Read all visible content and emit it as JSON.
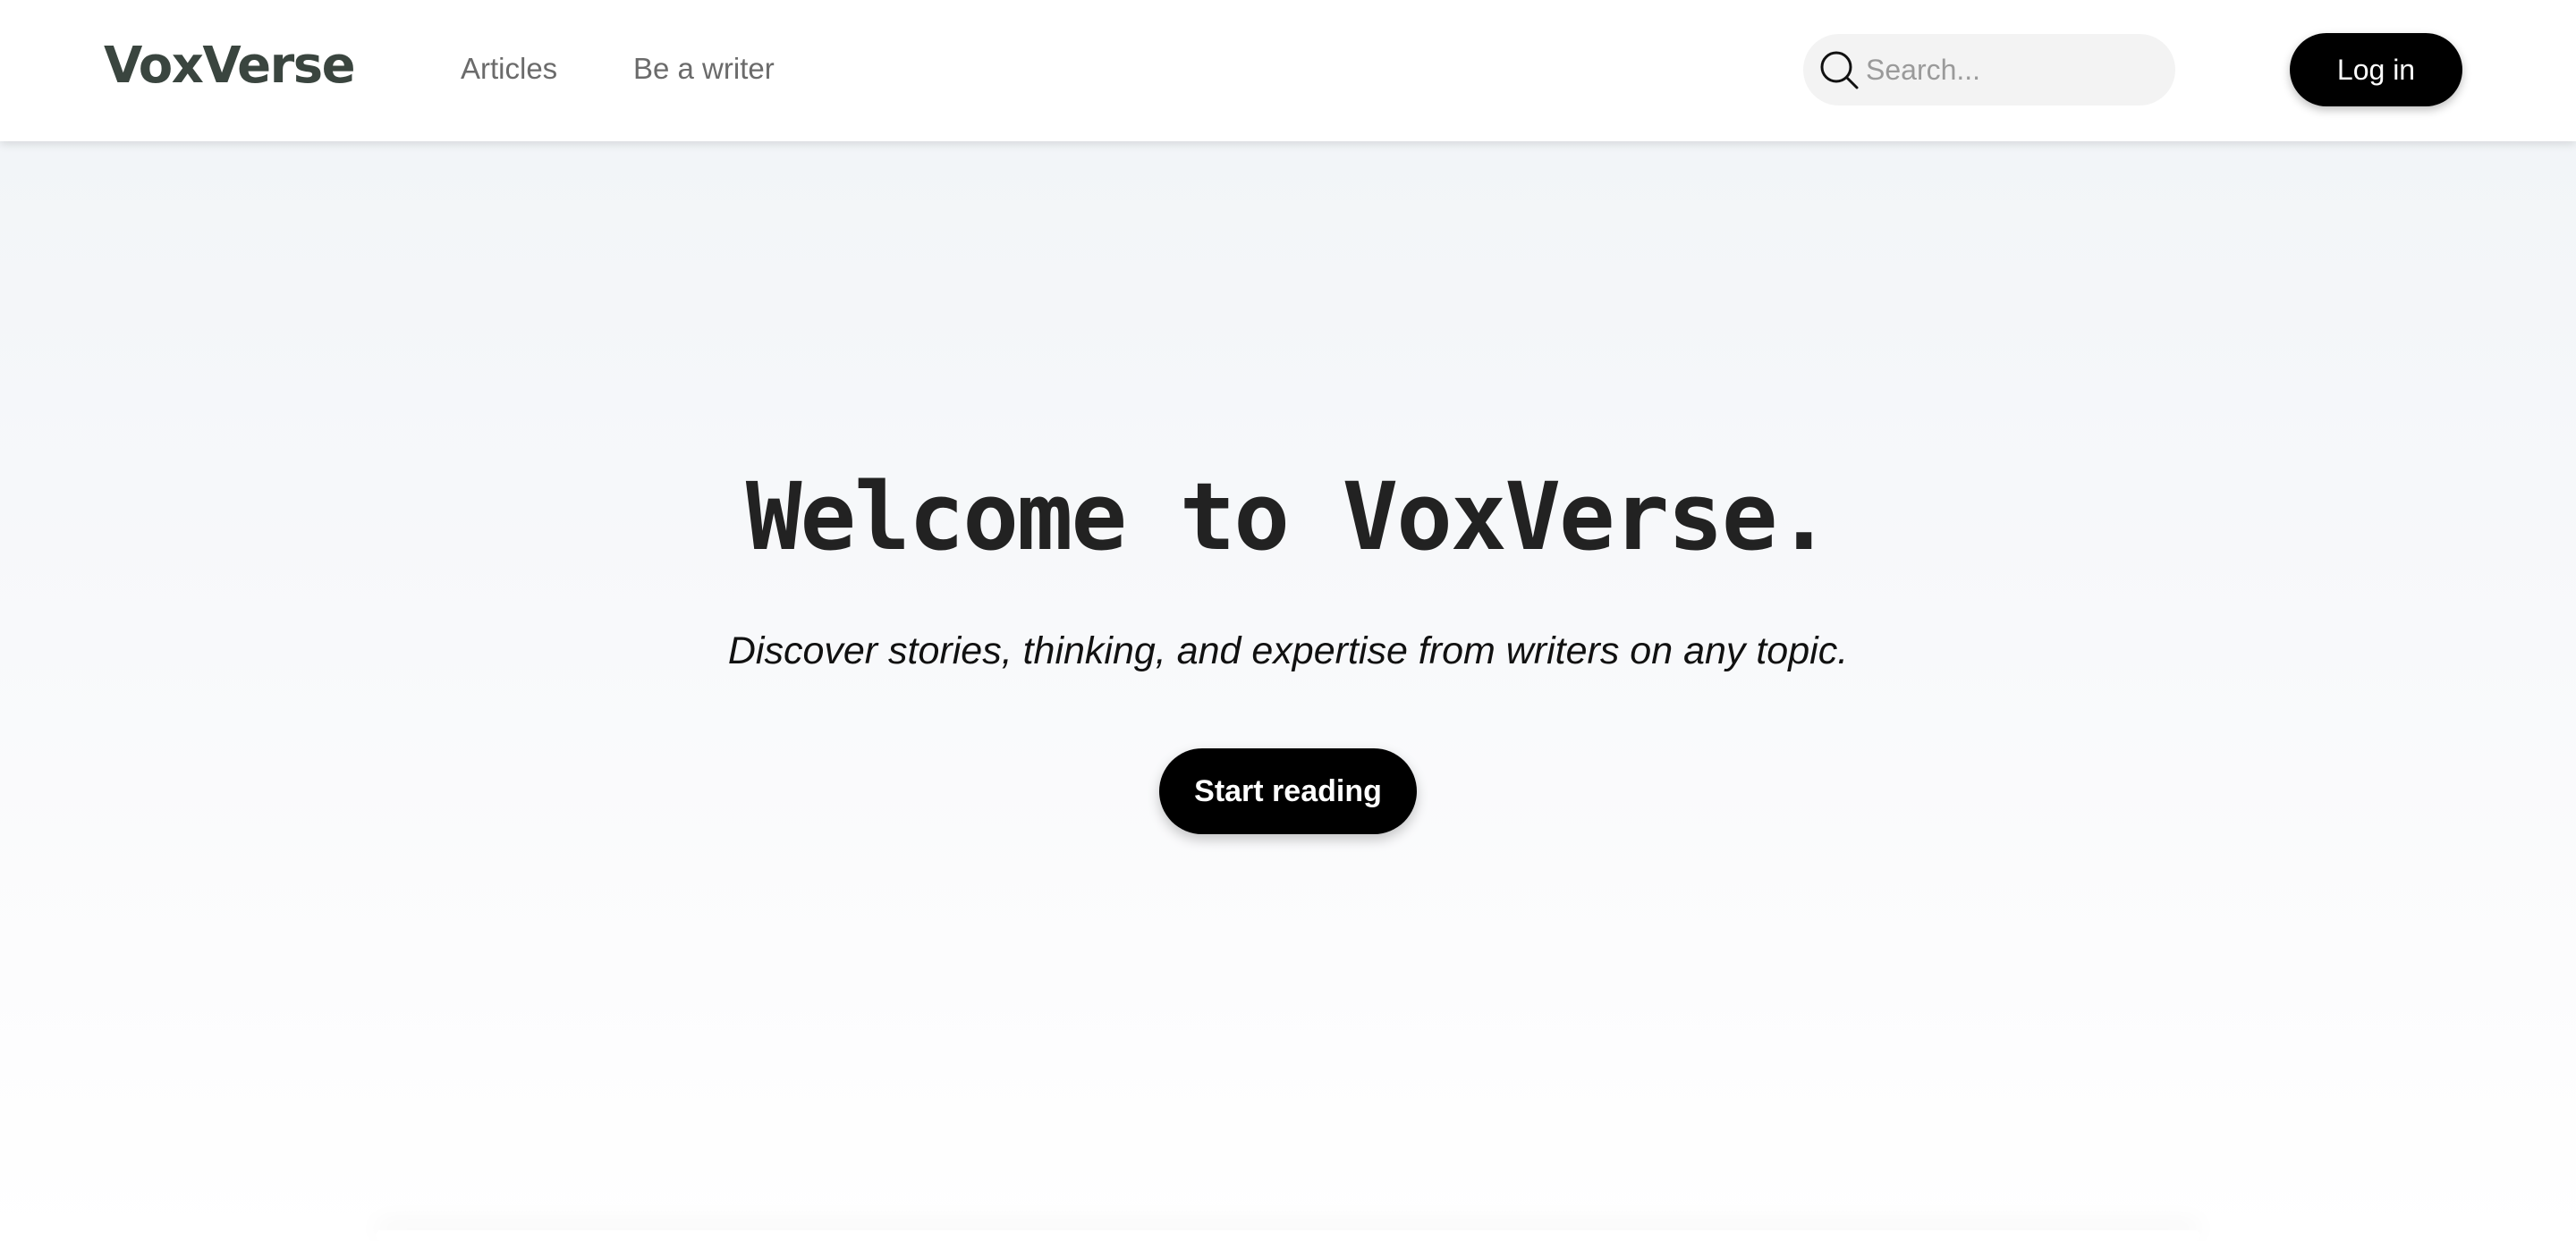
{
  "header": {
    "logo": "VoxVerse",
    "nav": [
      {
        "label": "Articles"
      },
      {
        "label": "Be a writer"
      }
    ],
    "search": {
      "placeholder": "Search...",
      "value": "",
      "icon": "search-icon"
    },
    "login_label": "Log in"
  },
  "hero": {
    "title": "Welcome to VoxVerse.",
    "subtitle": "Discover stories, thinking, and expertise from writers on any topic.",
    "cta_label": "Start reading"
  },
  "colors": {
    "logo": "#3a453f",
    "button_bg": "#000000",
    "button_text": "#ffffff",
    "nav_text": "#6b6b6b",
    "hero_bg_top": "#f2f5f8",
    "title_text": "#222222"
  }
}
